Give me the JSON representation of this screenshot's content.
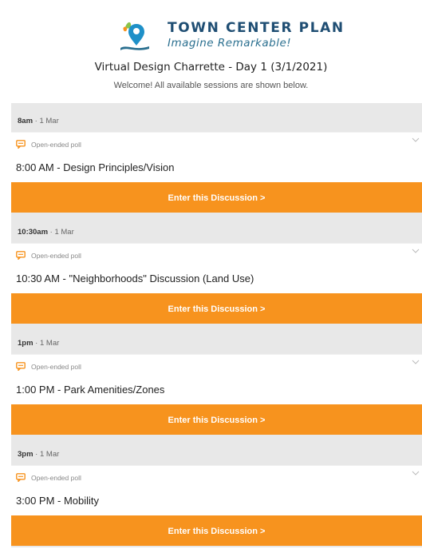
{
  "brand": {
    "title": "TOWN CENTER PLAN",
    "tagline": "Imagine Remarkable!"
  },
  "event": {
    "title": "Virtual Design Charrette - Day 1 (3/1/2021)",
    "subtitle": "Welcome! All available sessions are shown below."
  },
  "sessions": [
    {
      "time": "8am",
      "date": " · 1 Mar",
      "type": "Open-ended poll",
      "title": "8:00 AM - Design Principles/Vision",
      "button": "Enter this Discussion >"
    },
    {
      "time": "10:30am",
      "date": " · 1 Mar",
      "type": "Open-ended poll",
      "title": "10:30 AM - \"Neighborhoods\" Discussion (Land Use)",
      "button": "Enter this Discussion >"
    },
    {
      "time": "1pm",
      "date": " · 1 Mar",
      "type": "Open-ended poll",
      "title": "1:00 PM - Park Amenities/Zones",
      "button": "Enter this Discussion >"
    },
    {
      "time": "3pm",
      "date": " · 1 Mar",
      "type": "Open-ended poll",
      "title": "3:00 PM - Mobility",
      "button": "Enter this Discussion >"
    }
  ],
  "colors": {
    "accent": "#f7931e",
    "brand": "#1f4e73",
    "time_bar": "#e8e8e8"
  },
  "icons": {
    "logo": "location-pin-logo-icon",
    "poll": "chat-bubbles-icon",
    "expand": "chevron-down-icon"
  }
}
